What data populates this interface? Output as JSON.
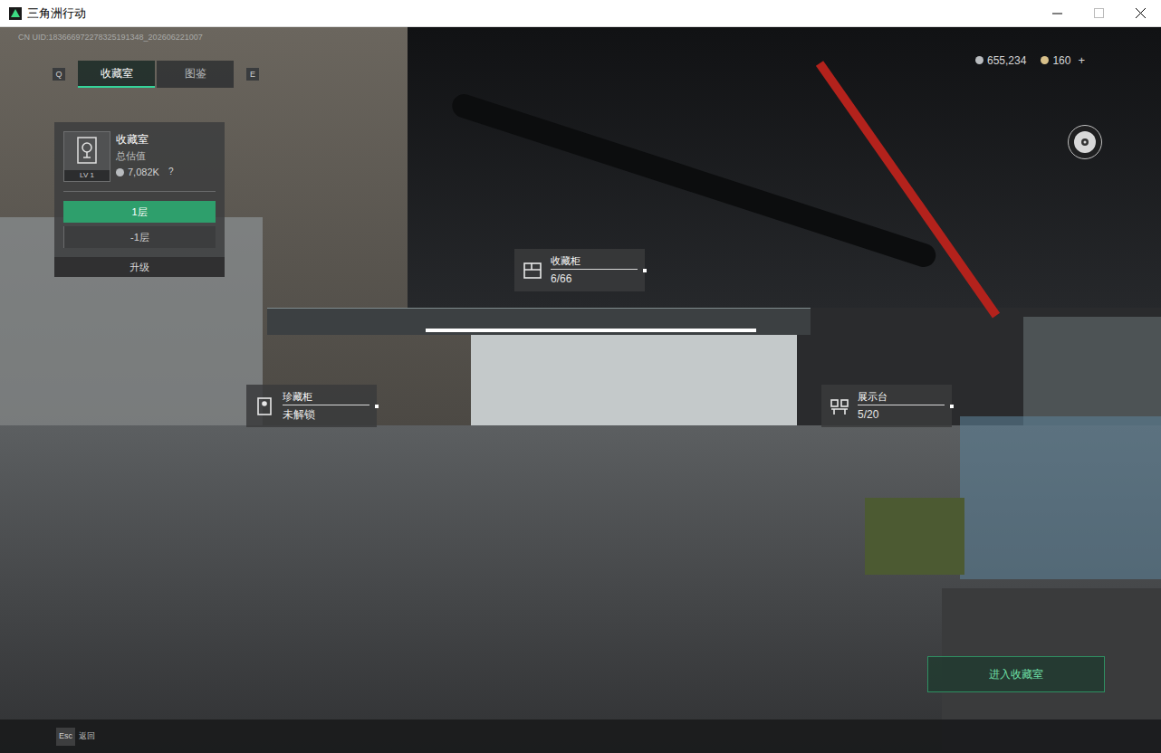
{
  "window": {
    "title": "三角洲行动"
  },
  "uid": "CN UID:183666972278325191348_202606221007",
  "tab_keys": [
    "Q",
    "E"
  ],
  "tabs": [
    {
      "label": "收藏室",
      "selected": true
    },
    {
      "label": "图鉴",
      "selected": false
    }
  ],
  "currencies": [
    {
      "amount": "655,234",
      "color": "#b9bcbf"
    },
    {
      "amount": "160",
      "color": "#d8c08a"
    }
  ],
  "currency_add": "+",
  "collection_panel": {
    "title": "收藏室",
    "level": "LV 1",
    "subtitle": "总估值",
    "value": "7,082K",
    "help": "?",
    "floors": [
      {
        "label": "1层",
        "selected": true
      },
      {
        "label": "-1层",
        "selected": false
      }
    ],
    "upgrade": "升级"
  },
  "markers": [
    {
      "name": "收藏柜",
      "status": "6/66"
    },
    {
      "name": "珍藏柜",
      "status": "未解锁"
    },
    {
      "name": "展示台",
      "status": "5/20"
    }
  ],
  "enter_button": "进入收藏室",
  "footer": {
    "key": "Esc",
    "label": "返回"
  }
}
